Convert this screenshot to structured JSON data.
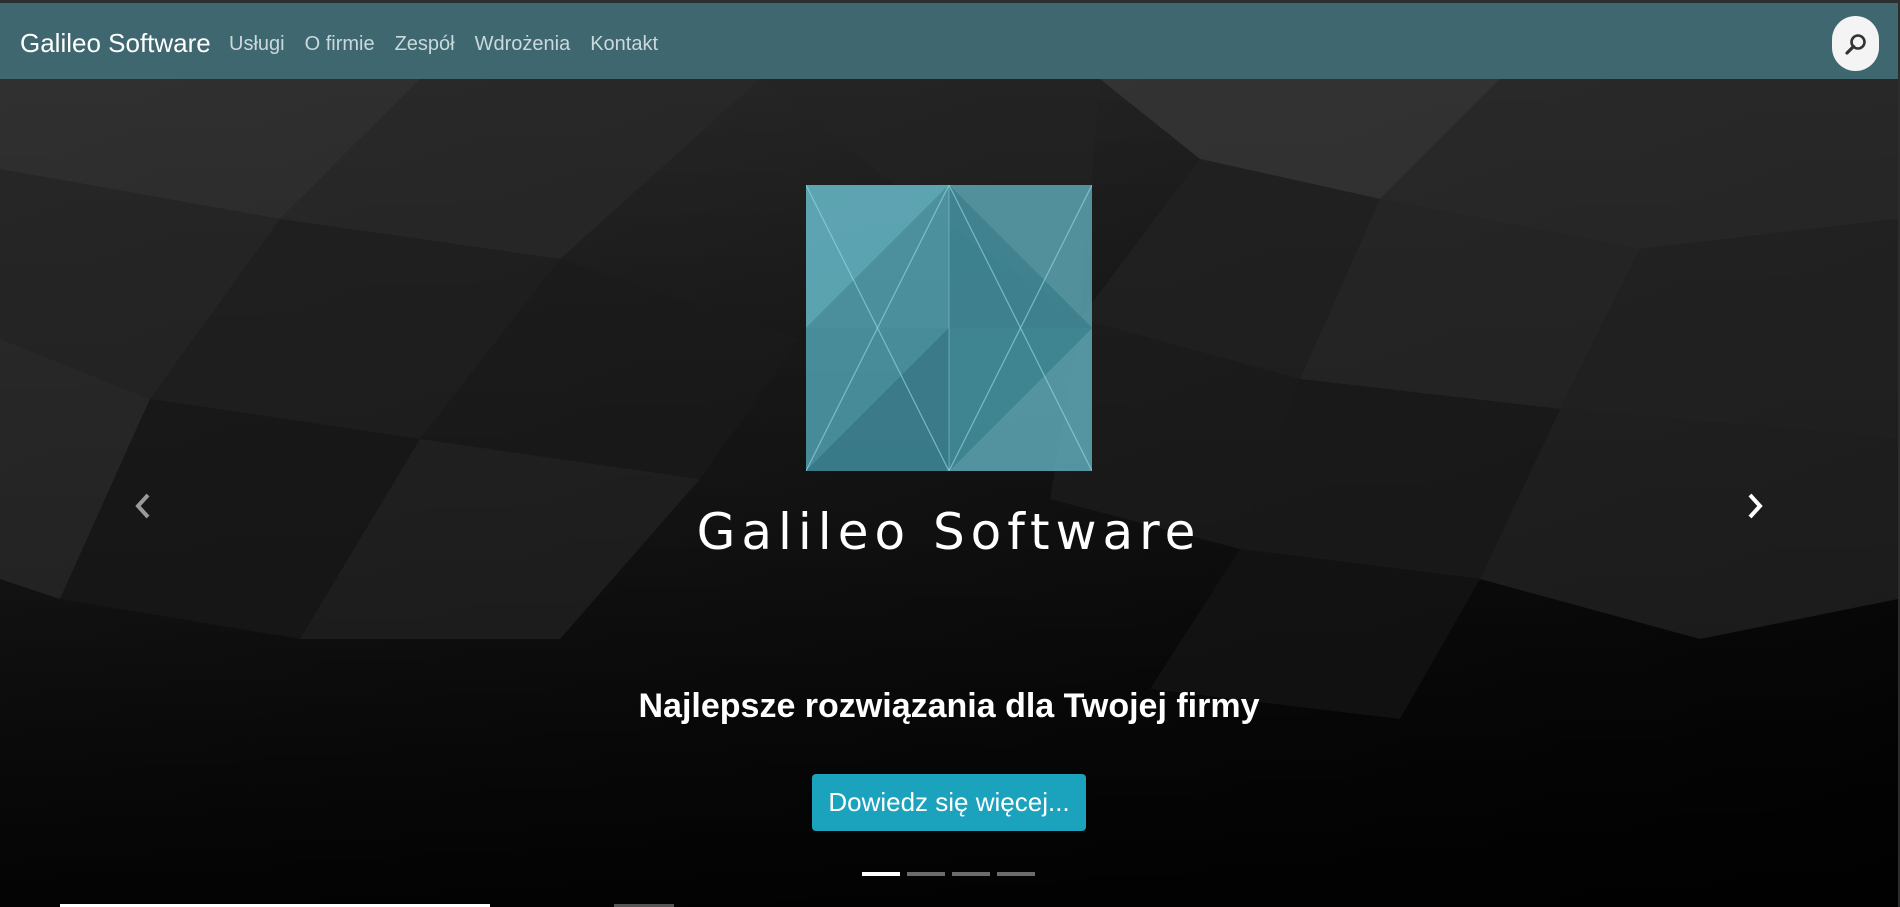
{
  "navbar": {
    "brand": "Galileo Software",
    "links": [
      "Usługi",
      "O firmie",
      "Zespół",
      "Wdrożenia",
      "Kontakt"
    ],
    "search_icon": "search-icon",
    "background": "#3f676f"
  },
  "hero": {
    "logo_text": "Galileo Software",
    "tagline": "Najlepsze rozwiązania dla Twojej firmy",
    "cta_label": "Dowiedz się więcej...",
    "cta_color": "#1ba2bd",
    "prev_icon": "chevron-left-icon",
    "next_icon": "chevron-right-icon",
    "slides_total": 4,
    "active_slide": 1
  }
}
